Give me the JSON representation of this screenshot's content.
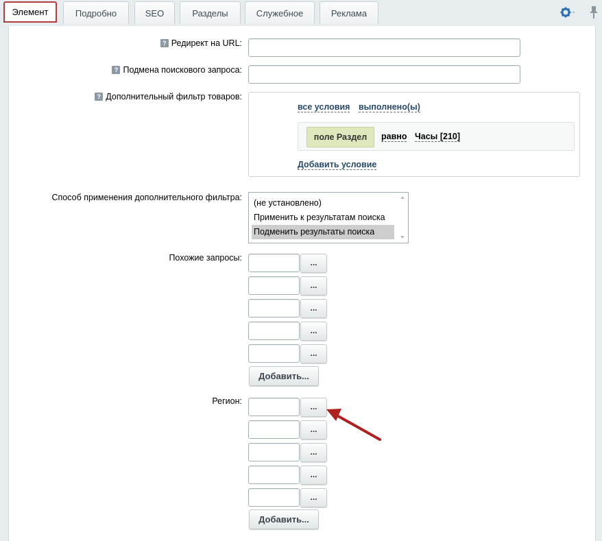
{
  "tabs": [
    {
      "label": "Элемент",
      "active": true
    },
    {
      "label": "Подробно",
      "active": false
    },
    {
      "label": "SEO",
      "active": false
    },
    {
      "label": "Разделы",
      "active": false
    },
    {
      "label": "Служебное",
      "active": false
    },
    {
      "label": "Реклама",
      "active": false
    }
  ],
  "help_glyph": "?",
  "fields": {
    "redirect_label": "Редирект на URL:",
    "redirect_value": "",
    "search_replace_label": "Подмена поискового запроса:",
    "search_replace_value": "",
    "extra_filter_label": "Дополнительный фильтр товаров:",
    "filter": {
      "all_conditions": "все условия",
      "fulfilled": "выполнено(ы)",
      "field": "поле Раздел",
      "operator": "равно",
      "value": "Часы [210]",
      "add_condition": "Добавить условие"
    },
    "apply_method_label": "Способ применения дополнительного фильтра:",
    "apply_options": [
      "(не установлено)",
      "Применить к результатам поиска",
      "Подменить результаты поиска"
    ],
    "apply_selected": "Подменить результаты поиска",
    "similar_label": "Похожие запросы:",
    "similar_values": [
      "",
      "",
      "",
      "",
      ""
    ],
    "region_label": "Регион:",
    "region_values": [
      "",
      "",
      "",
      "",
      ""
    ],
    "dots_label": "...",
    "add_label": "Добавить..."
  },
  "colors": {
    "active_tab_border": "#b53c3c",
    "arrow": "#b02020",
    "gear": "#2a6fb5",
    "chip_bg": "#dfe8bd"
  }
}
